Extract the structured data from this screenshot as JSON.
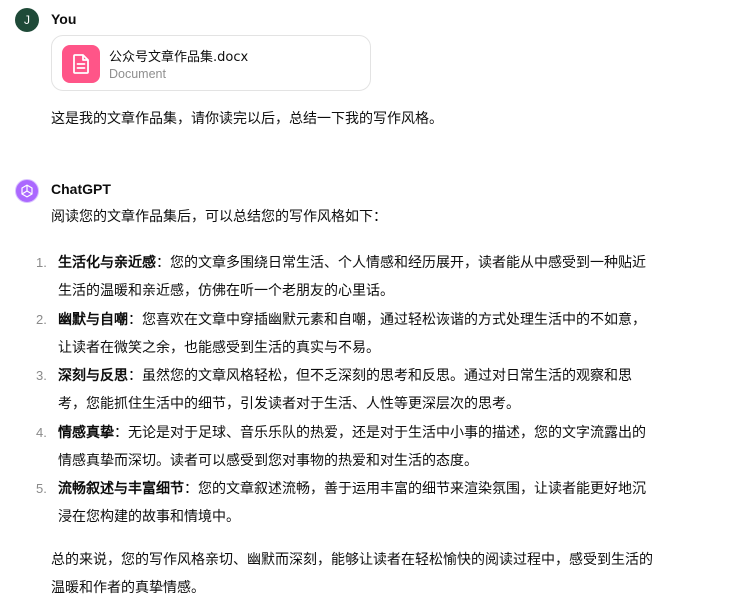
{
  "user": {
    "avatar_initial": "J",
    "author": "You",
    "attachment": {
      "file_name": "公众号文章作品集.docx",
      "file_type": "Document",
      "icon": "document-icon",
      "icon_color": "#ff5588"
    },
    "message": "这是我的文章作品集，请你读完以后，总结一下我的写作风格。"
  },
  "assistant": {
    "author": "ChatGPT",
    "icon": "openai-logo-icon",
    "intro": "阅读您的文章作品集后，可以总结您的写作风格如下：",
    "items": [
      {
        "number": "1.",
        "title": "生活化与亲近感",
        "line1": "：您的文章多围绕日常生活、个人情感和经历展开，读者能从中感受到一种贴近",
        "line2": "生活的温暖和亲近感，仿佛在听一个老朋友的心里话。"
      },
      {
        "number": "2.",
        "title": "幽默与自嘲",
        "line1": "：您喜欢在文章中穿插幽默元素和自嘲，通过轻松诙谐的方式处理生活中的不如意，",
        "line2": "让读者在微笑之余，也能感受到生活的真实与不易。"
      },
      {
        "number": "3.",
        "title": "深刻与反思",
        "line1": "：虽然您的文章风格轻松，但不乏深刻的思考和反思。通过对日常生活的观察和思",
        "line2": "考，您能抓住生活中的细节，引发读者对于生活、人性等更深层次的思考。"
      },
      {
        "number": "4.",
        "title": "情感真挚",
        "line1": "：无论是对于足球、音乐乐队的热爱，还是对于生活中小事的描述，您的文字流露出的",
        "line2": "情感真挚而深切。读者可以感受到您对事物的热爱和对生活的态度。"
      },
      {
        "number": "5.",
        "title": "流畅叙述与丰富细节",
        "line1": "：您的文章叙述流畅，善于运用丰富的细节来渲染氛围，让读者能更好地沉",
        "line2": "浸在您构建的故事和情境中。"
      }
    ],
    "summary_line1": "总的来说，您的写作风格亲切、幽默而深刻，能够让读者在轻松愉快的阅读过程中，感受到生活的",
    "summary_line2": "温暖和作者的真挚情感。"
  }
}
